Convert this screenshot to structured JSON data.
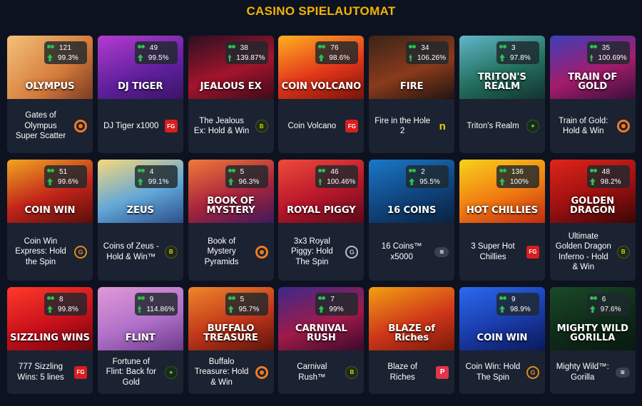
{
  "page_title": "CASINO SPIELAUTOMAT",
  "rows": [
    [
      {
        "name": "Gates of Olympus Super Scatter",
        "thumb_text": "OLYMPUS",
        "count": "121",
        "rtp": "99.3%",
        "provider_icon": "pragmatic-play-icon",
        "provider_class": "ring",
        "provider_glyph": "",
        "bg": "linear-gradient(135deg,#f3c27a,#d57a3a 60%,#7a3b23)"
      },
      {
        "name": "DJ Tiger x1000",
        "thumb_text": "DJ TIGER",
        "count": "49",
        "rtp": "99.5%",
        "provider_icon": "fg-icon",
        "provider_class": "fg",
        "provider_glyph": "FG",
        "bg": "linear-gradient(160deg,#b33ccf,#5e1f9b 60%,#3a1468)"
      },
      {
        "name": "The Jealous Ex: Hold & Win",
        "thumb_text": "JEALOUS EX",
        "count": "38",
        "rtp": "139.87%",
        "provider_icon": "booming-icon",
        "provider_class": "booming",
        "provider_glyph": "B",
        "bg": "linear-gradient(160deg,#2a1020,#a3142d 55%,#3e0b18)"
      },
      {
        "name": "Coin Volcano",
        "thumb_text": "COIN VOLCANO",
        "count": "76",
        "rtp": "98.6%",
        "provider_icon": "fg-icon",
        "provider_class": "fg",
        "provider_glyph": "FG",
        "bg": "linear-gradient(160deg,#ffb020,#e2361a 55%,#7a1208)"
      },
      {
        "name": "Fire in the Hole 2",
        "thumb_text": "FIRE",
        "count": "34",
        "rtp": "106.26%",
        "provider_icon": "nolimit-icon",
        "provider_class": "n",
        "provider_glyph": "n",
        "bg": "linear-gradient(160deg,#3a2418,#8a3a1c 55%,#201510)"
      },
      {
        "name": "Triton's Realm",
        "thumb_text": "TRITON'S REALM",
        "count": "3",
        "rtp": "97.8%",
        "provider_icon": "bull-icon",
        "provider_class": "bull",
        "provider_glyph": "★",
        "bg": "linear-gradient(160deg,#5fb6c9,#24705f 55%,#12332f)"
      },
      {
        "name": "Train of Gold: Hold & Win",
        "thumb_text": "TRAIN OF GOLD",
        "count": "35",
        "rtp": "100.69%",
        "provider_icon": "playson-icon",
        "provider_class": "ring",
        "provider_glyph": "",
        "bg": "linear-gradient(160deg,#3b3fb8,#a41c6c 55%,#3a0f3a)"
      }
    ],
    [
      {
        "name": "Coin Win Express: Hold the Spin",
        "thumb_text": "COIN WIN",
        "count": "51",
        "rtp": "99.6%",
        "provider_icon": "gamzix-icon",
        "provider_class": "gamzix-orange",
        "provider_glyph": "G",
        "bg": "linear-gradient(160deg,#f2a622,#c0241a 55%,#5b0e0a)"
      },
      {
        "name": "Coins of Zeus - Hold & Win™",
        "thumb_text": "ZEUS",
        "count": "4",
        "rtp": "99.1%",
        "provider_icon": "booming-icon",
        "provider_class": "booming",
        "provider_glyph": "B",
        "bg": "linear-gradient(160deg,#f7d87a,#62a7d8 55%,#2b4e8a)"
      },
      {
        "name": "Book of Mystery Pyramids",
        "thumb_text": "BOOK OF MYSTERY",
        "count": "5",
        "rtp": "96.3%",
        "provider_icon": "playson-icon",
        "provider_class": "ring",
        "provider_glyph": "",
        "bg": "linear-gradient(160deg,#f07a3a,#a8243c 55%,#3e1a5a)"
      },
      {
        "name": "3x3 Royal Piggy: Hold The Spin",
        "thumb_text": "ROYAL PIGGY",
        "count": "46",
        "rtp": "100.46%",
        "provider_icon": "gamzix-icon",
        "provider_class": "gamzix",
        "provider_glyph": "G",
        "bg": "linear-gradient(160deg,#f04a3a,#b6162a 55%,#5a0a1a)"
      },
      {
        "name": "16 Coins™ x5000",
        "thumb_text": "16 COINS",
        "count": "2",
        "rtp": "95.5%",
        "provider_icon": "swintt-icon",
        "provider_class": "swing",
        "provider_glyph": "≋",
        "bg": "linear-gradient(160deg,#1a78c8,#10447e 55%,#0a223e)"
      },
      {
        "name": "3 Super Hot Chillies",
        "thumb_text": "HOT CHILLIES",
        "count": "136",
        "rtp": "100%",
        "provider_icon": "fg-icon",
        "provider_class": "fg",
        "provider_glyph": "FG",
        "bg": "linear-gradient(160deg,#f8d21a,#f07a12 55%,#c02a10)"
      },
      {
        "name": "Ultimate Golden Dragon Inferno - Hold & Win",
        "thumb_text": "GOLDEN DRAGON",
        "count": "48",
        "rtp": "98.2%",
        "provider_icon": "booming-icon",
        "provider_class": "booming",
        "provider_glyph": "B",
        "bg": "linear-gradient(160deg,#e0241a,#9a1010 55%,#3a0606)"
      }
    ],
    [
      {
        "name": "777 Sizzling Wins: 5 lines",
        "thumb_text": "SIZZLING WINS",
        "count": "8",
        "rtp": "99.8%",
        "provider_icon": "fg-icon",
        "provider_class": "fg",
        "provider_glyph": "FG",
        "bg": "linear-gradient(160deg,#ff3a2a,#c8101a 55%,#6a0610)"
      },
      {
        "name": "Fortune of Flint: Back for Gold",
        "thumb_text": "FLINT",
        "count": "9",
        "rtp": "114.86%",
        "provider_icon": "bull-icon",
        "provider_class": "bull",
        "provider_glyph": "★",
        "bg": "linear-gradient(160deg,#e09ad8,#b070c8 55%,#6a3a8a)"
      },
      {
        "name": "Buffalo Treasure: Hold & Win",
        "thumb_text": "BUFFALO TREASURE",
        "count": "5",
        "rtp": "95.7%",
        "provider_icon": "playson-icon",
        "provider_class": "ring",
        "provider_glyph": "",
        "bg": "linear-gradient(160deg,#f0862a,#c0361a 55%,#5a140a)"
      },
      {
        "name": "Carnival Rush™",
        "thumb_text": "CARNIVAL RUSH",
        "count": "7",
        "rtp": "99%",
        "provider_icon": "booming-icon",
        "provider_class": "booming",
        "provider_glyph": "B",
        "bg": "linear-gradient(160deg,#3a2a8a,#a01a4a 55%,#3a0a2a)"
      },
      {
        "name": "Blaze of Riches",
        "thumb_text": "BLAZE of Riches",
        "count": "",
        "rtp": "",
        "provider_icon": "p-icon",
        "provider_class": "p",
        "provider_glyph": "P",
        "bg": "linear-gradient(160deg,#f2a012,#d0361a 55%,#7a1a0a)"
      },
      {
        "name": "Coin Win: Hold The Spin",
        "thumb_text": "COIN WIN",
        "count": "9",
        "rtp": "98.9%",
        "provider_icon": "gamzix-icon",
        "provider_class": "gamzix-orange",
        "provider_glyph": "G",
        "bg": "linear-gradient(160deg,#2a6af0,#1a3aa8 55%,#0a1a5a)"
      },
      {
        "name": "Mighty Wild™: Gorilla",
        "thumb_text": "MIGHTY WILD GORILLA",
        "count": "6",
        "rtp": "97.6%",
        "provider_icon": "swintt-icon",
        "provider_class": "swing",
        "provider_glyph": "≋",
        "bg": "linear-gradient(160deg,#1a4a2a,#0f2a18 55%,#081a10)"
      }
    ]
  ]
}
